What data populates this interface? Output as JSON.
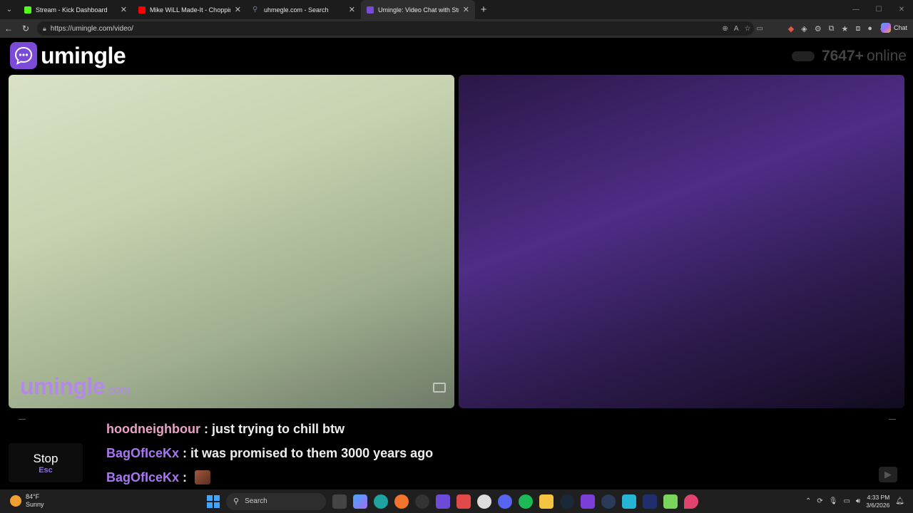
{
  "browser": {
    "tabs": [
      {
        "title": "Stream - Kick Dashboard",
        "color": "#53fc18",
        "active": false
      },
      {
        "title": "Mike WiLL Made-It - Choppin' Bla",
        "color": "#ff0000",
        "active": false
      },
      {
        "title": "uhmegle.com - Search",
        "color": "#3b82f6",
        "active": false
      },
      {
        "title": "Umingle: Video Chat with Str",
        "color": "#7b4bd8",
        "active": true
      }
    ],
    "url": "https://umingle.com/video/",
    "copilot_label": "Chat"
  },
  "site": {
    "logo_text": "umingle",
    "online_count": "7647+",
    "online_label": "online",
    "watermark_main": "umingle",
    "watermark_suffix": ".com",
    "accent": "#7b4bd8"
  },
  "chat": {
    "messages": [
      {
        "user": "hoodneighbour",
        "sep": " : ",
        "text": "just trying to chill btw",
        "user_color": "pink"
      },
      {
        "user": "BagOfIceKx",
        "sep": " : ",
        "text": "it was promised to them 3000 years ago",
        "user_color": "purple"
      },
      {
        "user": "BagOfIceKx",
        "sep": " : ",
        "text": "",
        "user_color": "purple",
        "emote": true
      }
    ],
    "stop_label": "Stop",
    "stop_shortcut": "Esc"
  },
  "taskbar": {
    "temperature": "84°F",
    "condition": "Sunny",
    "search_placeholder": "Search",
    "time": "4:33 PM",
    "date": "3/6/2026"
  }
}
